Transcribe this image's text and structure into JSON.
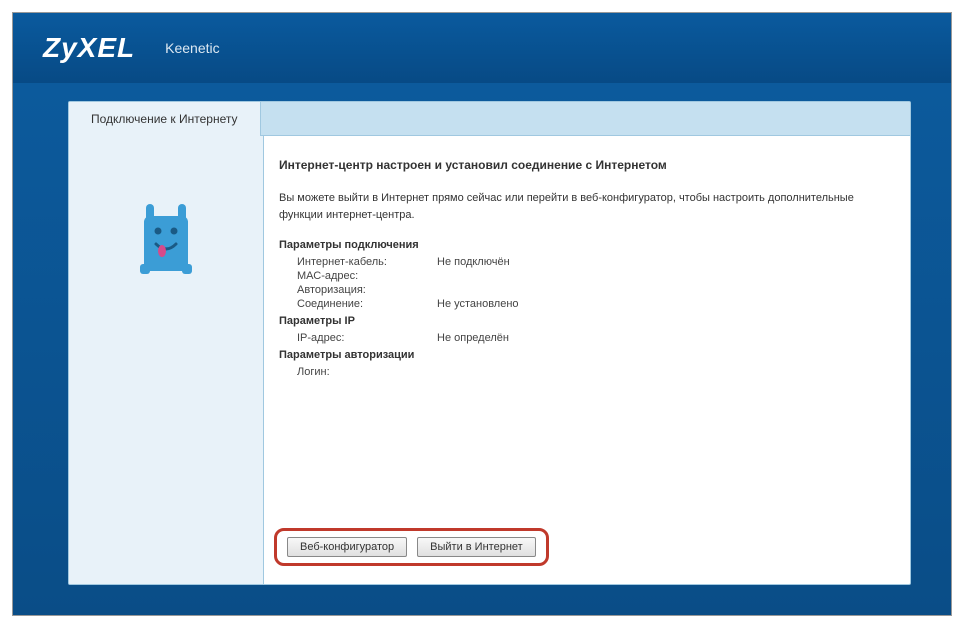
{
  "header": {
    "brand": "ZyXEL",
    "product": "Keenetic"
  },
  "tab": {
    "label": "Подключение к Интернету"
  },
  "content": {
    "title": "Интернет-центр настроен и установил соединение с Интернетом",
    "description": "Вы можете выйти в Интернет прямо сейчас или перейти в веб-конфигуратор, чтобы настроить дополнительные функции интернет-центра.",
    "sections": {
      "connection": {
        "heading": "Параметры подключения",
        "rows": [
          {
            "label": "Интернет-кабель:",
            "value": "Не подключён"
          },
          {
            "label": "МАС-адрес:",
            "value": ""
          },
          {
            "label": "Авторизация:",
            "value": ""
          },
          {
            "label": "Соединение:",
            "value": "Не установлено"
          }
        ]
      },
      "ip": {
        "heading": "Параметры IP",
        "rows": [
          {
            "label": "IP-адрес:",
            "value": "Не определён"
          }
        ]
      },
      "auth": {
        "heading": "Параметры авторизации",
        "rows": [
          {
            "label": "Логин:",
            "value": ""
          }
        ]
      }
    }
  },
  "buttons": {
    "web_configurator": "Веб-конфигуратор",
    "go_internet": "Выйти в Интернет"
  }
}
